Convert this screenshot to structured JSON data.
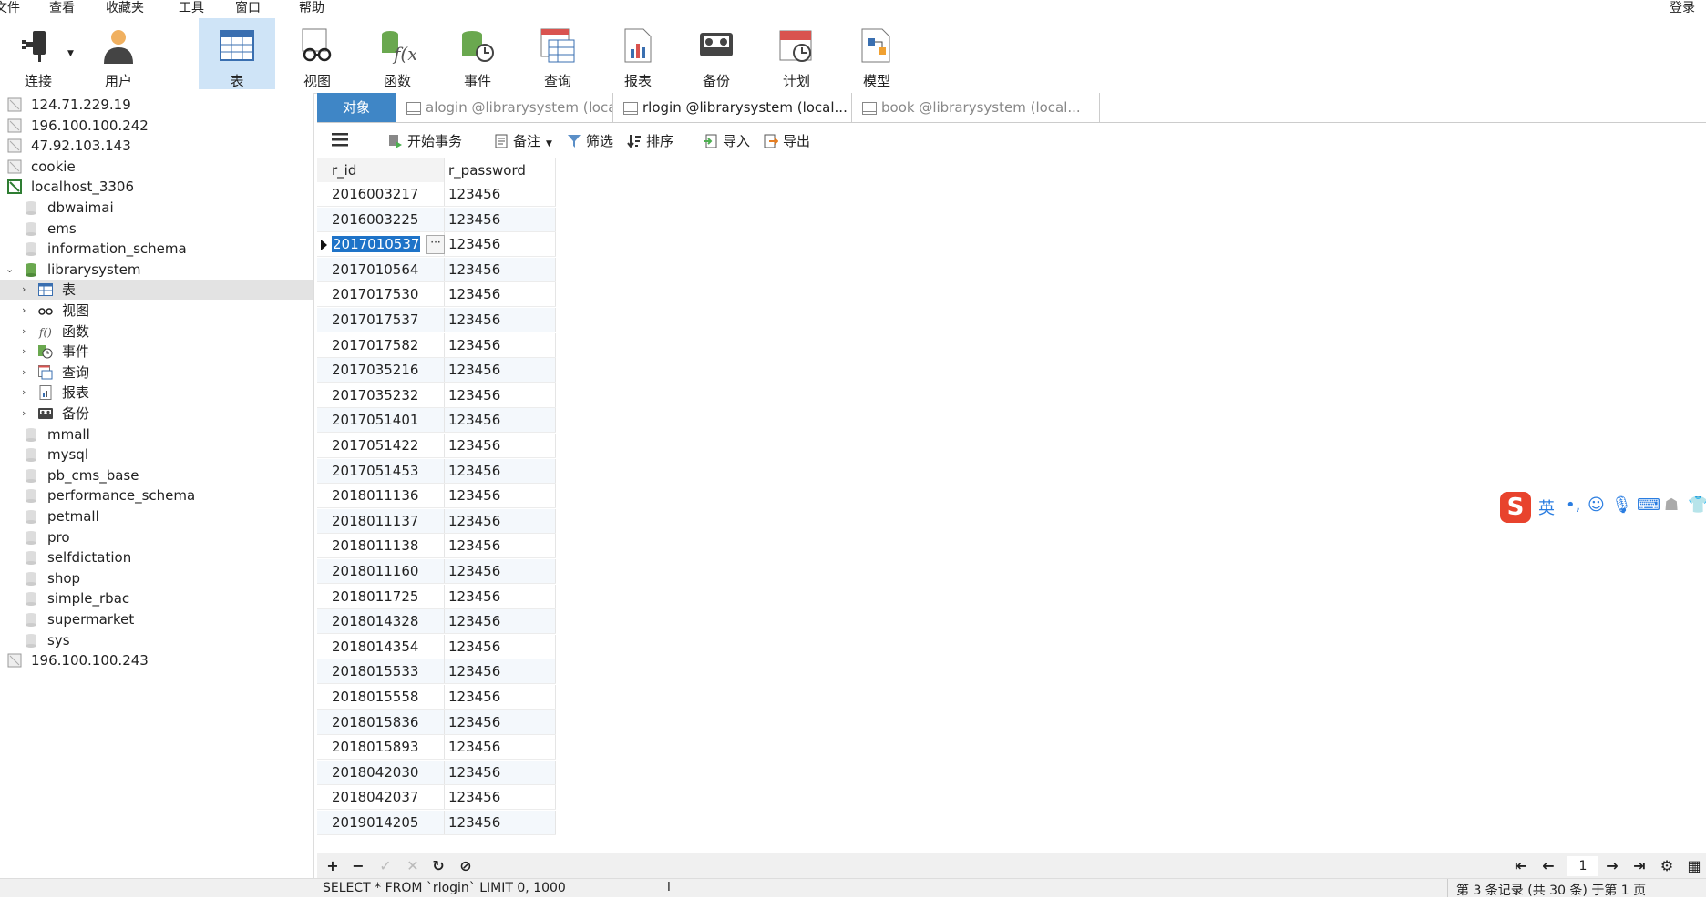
{
  "menu": {
    "items": [
      "文件",
      "查看",
      "收藏夹",
      "工具",
      "窗口",
      "帮助"
    ],
    "login": "登录"
  },
  "toolbar": {
    "items": [
      {
        "label": "连接",
        "icon": "plug-icon"
      },
      {
        "label": "用户",
        "icon": "user-icon"
      },
      {
        "label": "表",
        "icon": "table-icon"
      },
      {
        "label": "视图",
        "icon": "glasses-icon"
      },
      {
        "label": "函数",
        "icon": "function-icon"
      },
      {
        "label": "事件",
        "icon": "event-clock-icon"
      },
      {
        "label": "查询",
        "icon": "query-icon"
      },
      {
        "label": "报表",
        "icon": "report-icon"
      },
      {
        "label": "备份",
        "icon": "backup-icon"
      },
      {
        "label": "计划",
        "icon": "schedule-icon"
      },
      {
        "label": "模型",
        "icon": "model-icon"
      }
    ],
    "active_index": 2
  },
  "sidebar": {
    "nodes": [
      {
        "text": "124.71.229.19",
        "level": 0,
        "icon": "server-icon"
      },
      {
        "text": "196.100.100.242",
        "level": 0,
        "icon": "server-icon"
      },
      {
        "text": "47.92.103.143",
        "level": 0,
        "icon": "server-icon"
      },
      {
        "text": "cookie",
        "level": 0,
        "icon": "server-icon"
      },
      {
        "text": "localhost_3306",
        "level": 0,
        "icon": "server-connected-icon"
      },
      {
        "text": "dbwaimai",
        "level": 1,
        "icon": "database-icon"
      },
      {
        "text": "ems",
        "level": 1,
        "icon": "database-icon"
      },
      {
        "text": "information_schema",
        "level": 1,
        "icon": "database-icon"
      },
      {
        "text": "librarysystem",
        "level": 1,
        "icon": "database-open-icon",
        "expanded": true
      },
      {
        "text": "表",
        "level": 2,
        "icon": "table-icon",
        "selected": true
      },
      {
        "text": "视图",
        "level": 2,
        "icon": "glasses-icon"
      },
      {
        "text": "函数",
        "level": 2,
        "icon": "function-icon"
      },
      {
        "text": "事件",
        "level": 2,
        "icon": "event-clock-icon"
      },
      {
        "text": "查询",
        "level": 2,
        "icon": "query-icon"
      },
      {
        "text": "报表",
        "level": 2,
        "icon": "report-icon"
      },
      {
        "text": "备份",
        "level": 2,
        "icon": "backup-icon"
      },
      {
        "text": "mmall",
        "level": 1,
        "icon": "database-icon"
      },
      {
        "text": "mysql",
        "level": 1,
        "icon": "database-icon"
      },
      {
        "text": "pb_cms_base",
        "level": 1,
        "icon": "database-icon"
      },
      {
        "text": "performance_schema",
        "level": 1,
        "icon": "database-icon"
      },
      {
        "text": "petmall",
        "level": 1,
        "icon": "database-icon"
      },
      {
        "text": "pro",
        "level": 1,
        "icon": "database-icon"
      },
      {
        "text": "selfdictation",
        "level": 1,
        "icon": "database-icon"
      },
      {
        "text": "shop",
        "level": 1,
        "icon": "database-icon"
      },
      {
        "text": "simple_rbac",
        "level": 1,
        "icon": "database-icon"
      },
      {
        "text": "supermarket",
        "level": 1,
        "icon": "database-icon"
      },
      {
        "text": "sys",
        "level": 1,
        "icon": "database-icon"
      },
      {
        "text": "196.100.100.243",
        "level": 0,
        "icon": "server-icon"
      }
    ]
  },
  "tabs": [
    {
      "label": "对象",
      "kind": "object"
    },
    {
      "label": "alogin @librarysystem (loca...",
      "kind": "table"
    },
    {
      "label": "rlogin @librarysystem (local...",
      "kind": "table",
      "active": true
    },
    {
      "label": "book @librarysystem (local...",
      "kind": "table"
    }
  ],
  "object_toolbar": {
    "menu_icon": "hamburger-icon",
    "begin_transaction": "开始事务",
    "note": "备注",
    "filter": "筛选",
    "sort": "排序",
    "import": "导入",
    "export": "导出"
  },
  "grid": {
    "columns": [
      "r_id",
      "r_password"
    ],
    "selected_row": 2,
    "rows": [
      [
        "2016003217",
        "123456"
      ],
      [
        "2016003225",
        "123456"
      ],
      [
        "2017010537",
        "123456"
      ],
      [
        "2017010564",
        "123456"
      ],
      [
        "2017017530",
        "123456"
      ],
      [
        "2017017537",
        "123456"
      ],
      [
        "2017017582",
        "123456"
      ],
      [
        "2017035216",
        "123456"
      ],
      [
        "2017035232",
        "123456"
      ],
      [
        "2017051401",
        "123456"
      ],
      [
        "2017051422",
        "123456"
      ],
      [
        "2017051453",
        "123456"
      ],
      [
        "2018011136",
        "123456"
      ],
      [
        "2018011137",
        "123456"
      ],
      [
        "2018011138",
        "123456"
      ],
      [
        "2018011160",
        "123456"
      ],
      [
        "2018011725",
        "123456"
      ],
      [
        "2018014328",
        "123456"
      ],
      [
        "2018014354",
        "123456"
      ],
      [
        "2018015533",
        "123456"
      ],
      [
        "2018015558",
        "123456"
      ],
      [
        "2018015836",
        "123456"
      ],
      [
        "2018015893",
        "123456"
      ],
      [
        "2018042030",
        "123456"
      ],
      [
        "2018042037",
        "123456"
      ],
      [
        "2019014205",
        "123456"
      ]
    ]
  },
  "bottom_bar": {
    "page": "1"
  },
  "status": {
    "sql": "SELECT * FROM `rlogin` LIMIT 0, 1000",
    "record_info": "第 3 条记录 (共 30 条) 于第 1 页"
  },
  "ime": {
    "logo": "S",
    "mode": "英"
  },
  "colors": {
    "accent": "#3f86c6",
    "selection": "#1e73c8",
    "toolbar_active": "#cfe4f7"
  }
}
